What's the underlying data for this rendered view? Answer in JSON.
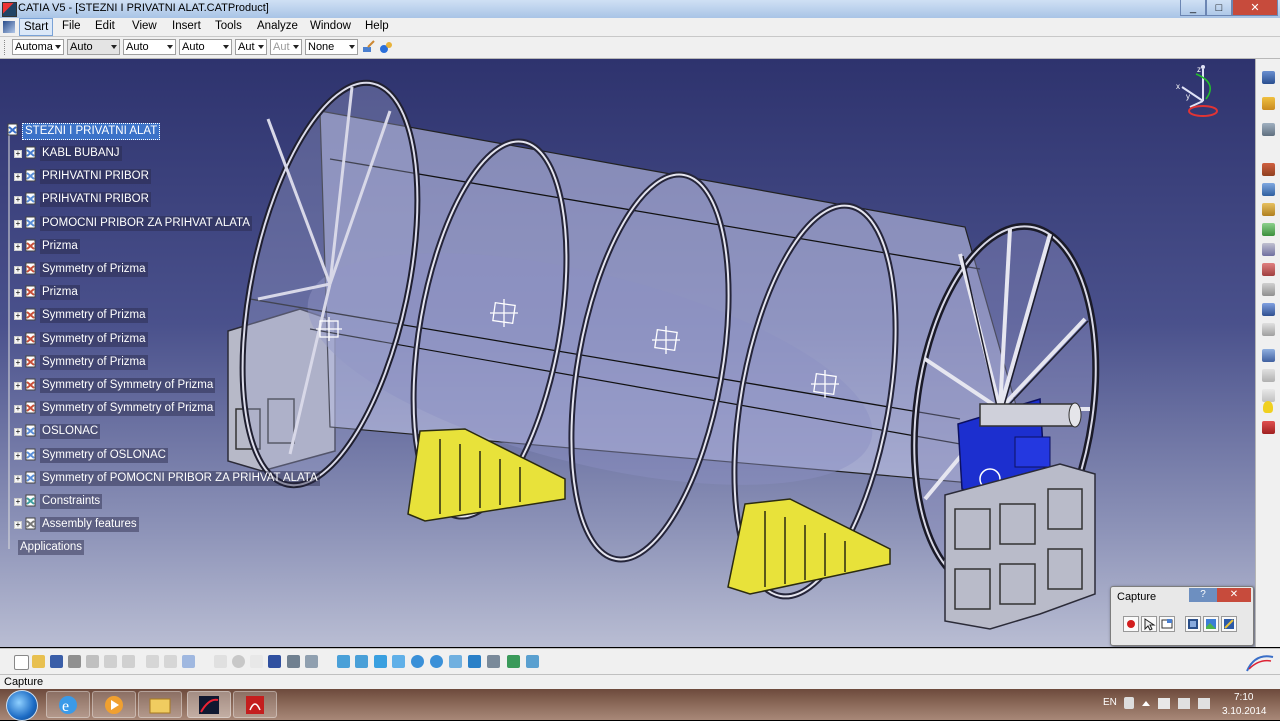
{
  "window": {
    "title": "CATIA V5 - [STEZNI I PRIVATNI ALAT.CATProduct]",
    "minimize": "_",
    "maximize": "□",
    "close": "✕"
  },
  "menu": {
    "items": [
      "Start",
      "File",
      "Edit",
      "View",
      "Insert",
      "Tools",
      "Analyze",
      "Window",
      "Help"
    ]
  },
  "toolbar": {
    "combos": [
      "Automa",
      "Auto",
      "Auto",
      "Auto",
      "Aut",
      "Aut",
      "None"
    ]
  },
  "tree": {
    "root": "STEZNI I PRIVATNI ALAT",
    "items": [
      "KABL BUBANJ",
      "PRIHVATNI PRIBOR",
      "PRIHVATNI PRIBOR",
      "POMOCNI PRIBOR ZA PRIHVAT ALATA",
      "Prizma",
      "Symmetry of Prizma",
      "Prizma",
      "Symmetry of Prizma",
      "Symmetry of Prizma",
      "Symmetry of Prizma",
      "Symmetry of Symmetry of Prizma",
      "Symmetry of Symmetry of Prizma",
      "OSLONAC",
      "Symmetry of OSLONAC",
      "Symmetry of POMOCNI PRIBOR ZA PRIHVAT ALATA",
      "Constraints",
      "Assembly features"
    ],
    "applications": "Applications"
  },
  "compass": {
    "x": "x",
    "y": "y",
    "z": "z"
  },
  "capture_panel": {
    "title": "Capture",
    "help": "?",
    "close": "✕"
  },
  "status": {
    "text": "Capture"
  },
  "taskbar": {
    "lang": "EN",
    "time": "7:10",
    "date": "3.10.2014"
  },
  "colors": {
    "viewport_top": "#2e336e",
    "viewport_bottom": "#b9bdd3",
    "selection": "#3b72c8",
    "support_yellow": "#e8e23a",
    "bearing_blue": "#1c2fcf"
  }
}
